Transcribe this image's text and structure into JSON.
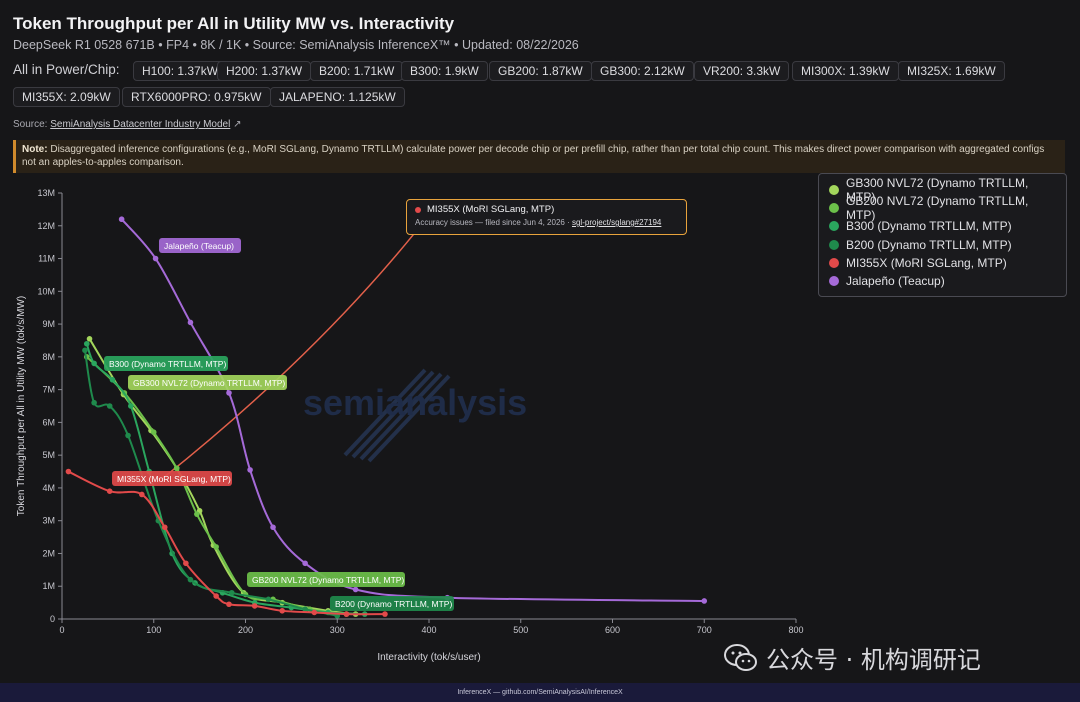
{
  "header": {
    "title": "Token Throughput per All in Utility MW vs. Interactivity",
    "subtitle": "DeepSeek R1 0528 671B • FP4 • 8K / 1K • Source: SemiAnalysis InferenceX™ • Updated: 08/22/2026",
    "power_label": "All in Power/Chip:",
    "chips": [
      "H100: 1.37kW",
      "H200: 1.37kW",
      "B200: 1.71kW",
      "B300: 1.9kW",
      "GB200: 1.87kW",
      "GB300: 2.12kW",
      "VR200: 3.3kW",
      "MI300X: 1.39kW",
      "MI325X: 1.69kW",
      "MI355X: 2.09kW",
      "RTX6000PRO: 0.975kW",
      "JALAPENO: 1.125kW"
    ],
    "source_prefix": "Source:",
    "source_link": "SemiAnalysis Datacenter Industry Model",
    "note_label": "Note:",
    "note_text": "Disaggregated inference configurations (e.g., MoRI SGLang, Dynamo TRTLLM) calculate power per decode chip or per prefill chip, rather than per total chip count. This makes direct power comparison with aggregated configs not an apples-to-apples comparison."
  },
  "tooltip": {
    "title": "MI355X (MoRI SGLang, MTP)",
    "desc": "Accuracy issues — filed since Jun 4, 2026 ·",
    "link": "sgl-project/sglang#27194"
  },
  "watermark": {
    "chart_watermark": "semianalysis",
    "text": "公众号 · 机构调研记"
  },
  "footer": "InferenceX — github.com/SemiAnalysisAI/InferenceX",
  "colors": {
    "gb300": "#a3d65c",
    "gb200": "#6cc04a",
    "b300": "#2aa65e",
    "b200": "#1f8a4c",
    "mi355x": "#e24a4a",
    "jalapeno": "#a56ad8",
    "bg": "#161618",
    "grid": "#2a2a2e"
  },
  "chart_data": {
    "type": "line",
    "xlabel": "Interactivity (tok/s/user)",
    "ylabel": "Token Throughput per All in Utility MW (tok/s/MW)",
    "xlim": [
      0,
      800
    ],
    "ylim": [
      0,
      13000000
    ],
    "x_ticks": [
      "0",
      "100",
      "200",
      "300",
      "400",
      "500",
      "600",
      "700",
      "800"
    ],
    "y_ticks": [
      "0",
      "1M",
      "2M",
      "3M",
      "4M",
      "5M",
      "6M",
      "7M",
      "8M",
      "9M",
      "10M",
      "11M",
      "12M",
      "13M"
    ],
    "grid": false,
    "legend_position": "top-right",
    "series": [
      {
        "name": "GB300 NVL72 (Dynamo TRTLLM, MTP)",
        "key": "gb300",
        "label": "GB300 NVL72 (Dynamo TRTLLM, MTP)",
        "x": [
          30,
          67,
          97,
          125,
          150,
          165,
          198,
          240,
          290,
          320
        ],
        "y": [
          8550000,
          6850000,
          5750000,
          4600000,
          3300000,
          2250000,
          800000,
          500000,
          250000,
          150000
        ]
      },
      {
        "name": "GB200 NVL72 (Dynamo TRTLLM, MTP)",
        "key": "gb200",
        "label": "GB200 NVL72 (Dynamo TRTLLM, MTP)",
        "x": [
          27,
          68,
          100,
          125,
          147,
          168,
          200,
          230,
          270,
          310
        ],
        "y": [
          8000000,
          6900000,
          5700000,
          4600000,
          3200000,
          2200000,
          750000,
          600000,
          300000,
          150000
        ]
      },
      {
        "name": "B300 (Dynamo TRTLLM, MTP)",
        "key": "b300",
        "label": "B300 (Dynamo TRTLLM, MTP)",
        "x": [
          27,
          35,
          55,
          75,
          95,
          120,
          145,
          175,
          210,
          250,
          290,
          330
        ],
        "y": [
          8400000,
          7800000,
          7300000,
          6500000,
          4500000,
          2000000,
          1100000,
          800000,
          500000,
          350000,
          200000,
          150000
        ]
      },
      {
        "name": "B200 (Dynamo TRTLLM, MTP)",
        "key": "b200",
        "label": "B200 (Dynamo TRTLLM, MTP)",
        "x": [
          25,
          35,
          52,
          72,
          105,
          140,
          185,
          225,
          265,
          300
        ],
        "y": [
          8200000,
          6600000,
          6500000,
          5600000,
          3000000,
          1200000,
          800000,
          600000,
          300000,
          100000
        ]
      },
      {
        "name": "MI355X (MoRI SGLang, MTP)",
        "key": "mi355x",
        "label": "MI355X (MoRI SGLang, MTP)",
        "x": [
          7,
          52,
          87,
          112,
          135,
          168,
          182,
          210,
          240,
          275,
          310,
          352
        ],
        "y": [
          4500000,
          3900000,
          3800000,
          2800000,
          1700000,
          700000,
          450000,
          400000,
          250000,
          200000,
          150000,
          150000
        ]
      },
      {
        "name": "Jalapeño (Teacup)",
        "key": "jalapeno",
        "label": "Jalapeño (Teacup)",
        "x": [
          65,
          102,
          140,
          182,
          205,
          230,
          265,
          320,
          420,
          700
        ],
        "y": [
          12200000,
          11000000,
          9050000,
          6900000,
          4550000,
          2800000,
          1700000,
          900000,
          650000,
          550000
        ]
      }
    ],
    "annotation_line": {
      "from": [
        110,
        4300000
      ],
      "to": [
        385,
        11800000
      ]
    }
  }
}
